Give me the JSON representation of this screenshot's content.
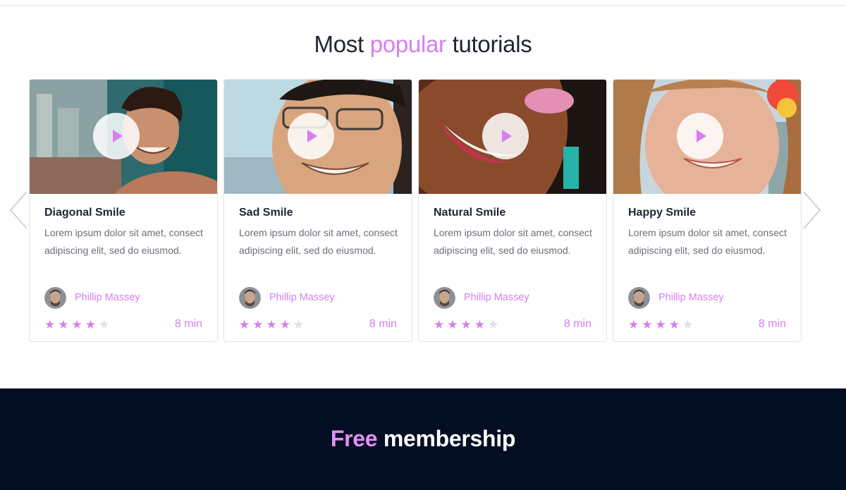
{
  "section": {
    "title_pre": "Most ",
    "title_accent": "popular",
    "title_post": " tutorials"
  },
  "carousel": {
    "prev_icon": "chevron-left-icon",
    "next_icon": "chevron-right-icon"
  },
  "cards": [
    {
      "title": "Diagonal Smile",
      "description": "Lorem ipsum dolor sit amet, consect adipiscing elit, sed do eiusmod.",
      "author": "Phillip Massey",
      "rating": 4,
      "rating_max": 5,
      "duration": "8 min"
    },
    {
      "title": "Sad Smile",
      "description": "Lorem ipsum dolor sit amet, consect adipiscing elit, sed do eiusmod.",
      "author": "Phillip Massey",
      "rating": 4,
      "rating_max": 5,
      "duration": "8 min"
    },
    {
      "title": "Natural Smile",
      "description": "Lorem ipsum dolor sit amet, consect adipiscing elit, sed do eiusmod.",
      "author": "Phillip Massey",
      "rating": 4,
      "rating_max": 5,
      "duration": "8 min"
    },
    {
      "title": "Happy Smile",
      "description": "Lorem ipsum dolor sit amet, consect adipiscing elit, sed do eiusmod.",
      "author": "Phillip Massey",
      "rating": 4,
      "rating_max": 5,
      "duration": "8 min"
    }
  ],
  "footer": {
    "title_accent": "Free",
    "title_rest": " membership"
  },
  "colors": {
    "accent": "#d67ff0",
    "footer_bg": "#040e22",
    "star_off": "#e0e0e4"
  }
}
